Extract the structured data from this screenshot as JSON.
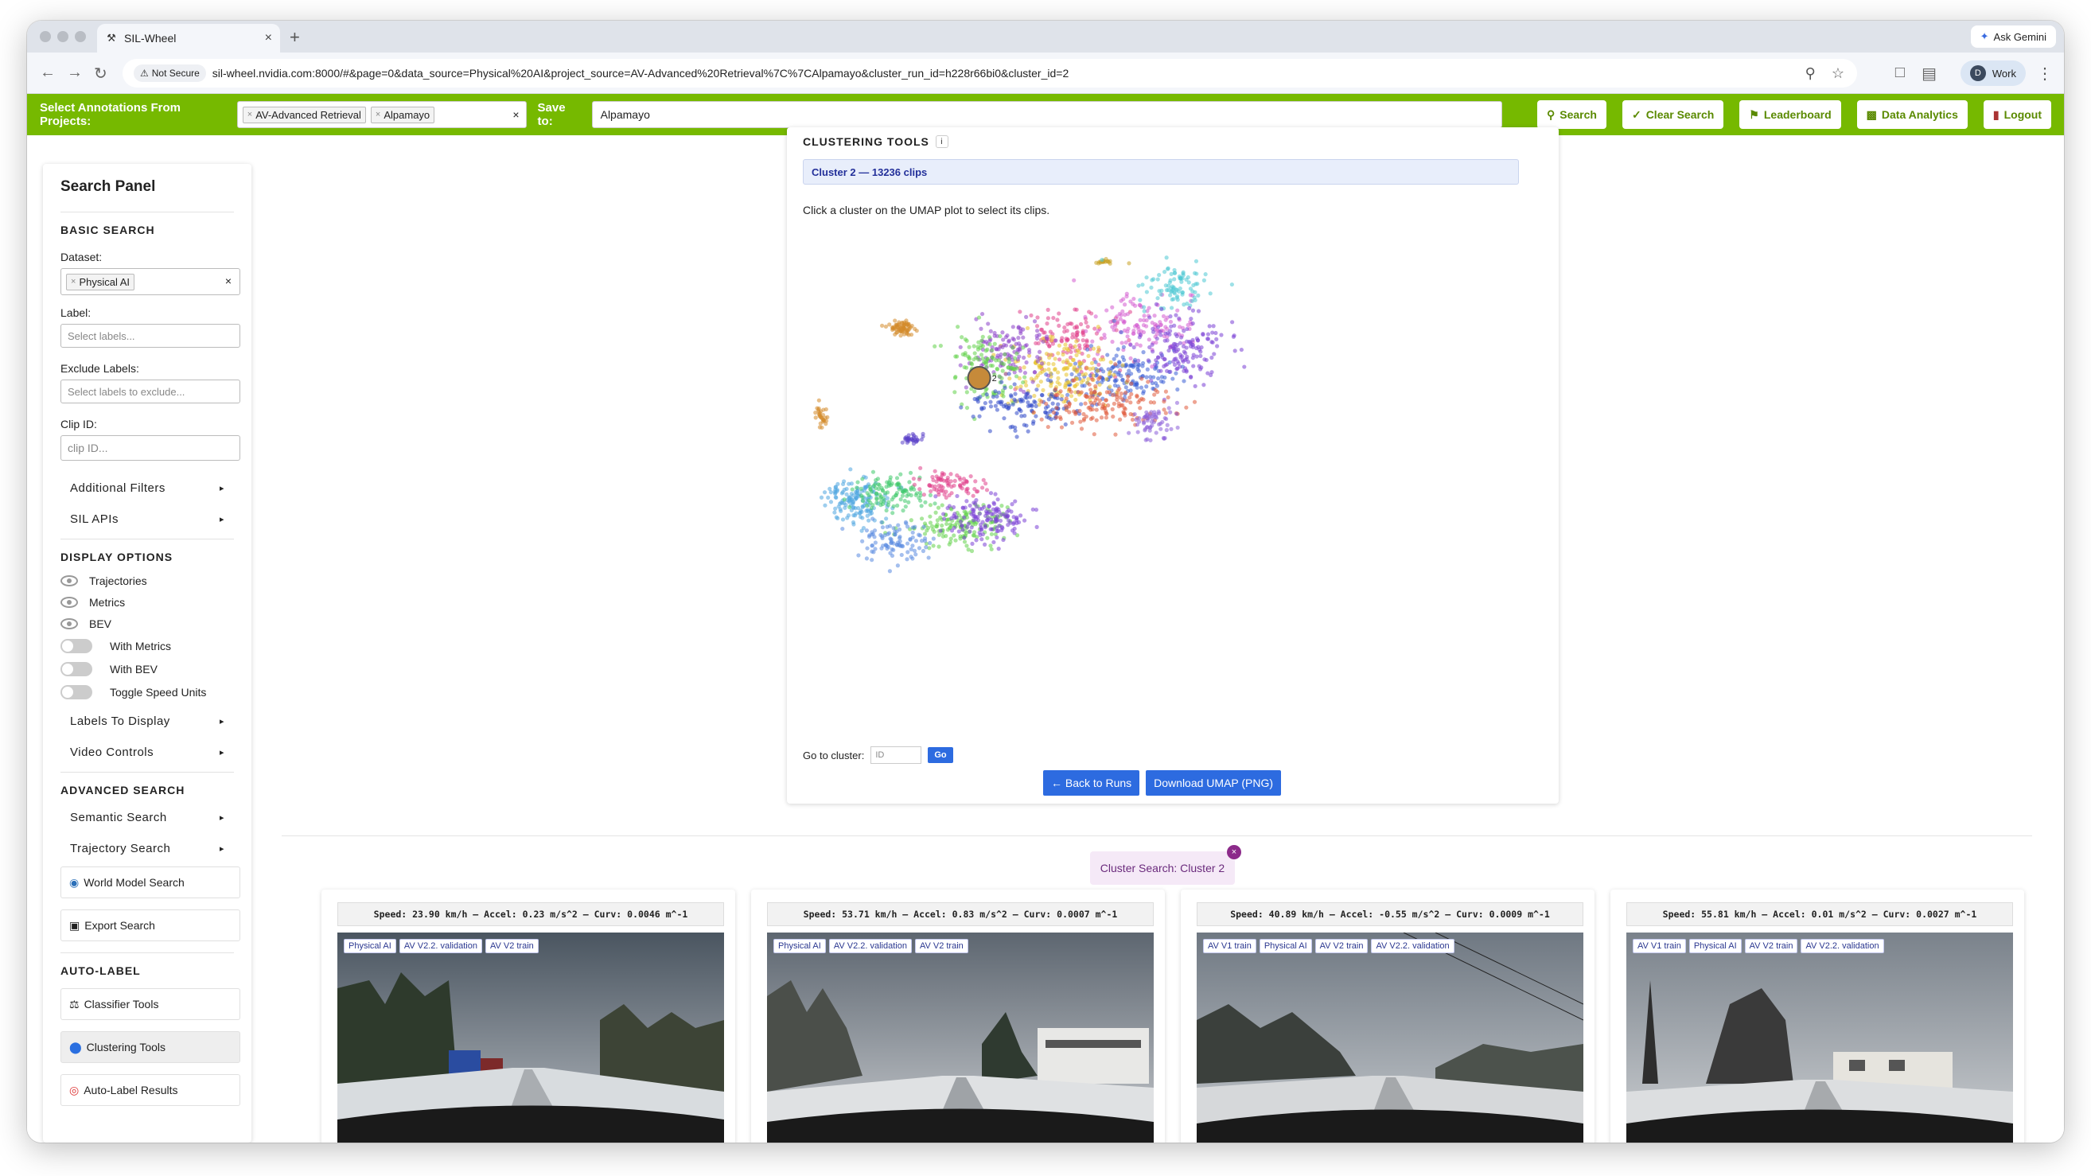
{
  "browser": {
    "tab_title": "SIL-Wheel",
    "new_tab": "+",
    "gemini_label": "Ask Gemini",
    "security_label": "Not Secure",
    "url": "sil-wheel.nvidia.com:8000/#&page=0&data_source=Physical%20AI&project_source=AV-Advanced%20Retrieval%7C%7CAlpamayo&cluster_run_id=h228r66bi0&cluster_id=2",
    "profile_initial": "D",
    "profile_label": "Work"
  },
  "appbar": {
    "select_label": "Select Annotations From Projects:",
    "projects": [
      "AV-Advanced Retrieval",
      "Alpamayo"
    ],
    "save_label": "Save to:",
    "save_value": "Alpamayo",
    "buttons": {
      "search": "Search",
      "clear": "Clear Search",
      "leaderboard": "Leaderboard",
      "analytics": "Data Analytics",
      "logout": "Logout"
    },
    "brand_color": "#76b900"
  },
  "sidebar": {
    "title": "Search Panel",
    "basic_search": "BASIC SEARCH",
    "dataset_label": "Dataset:",
    "dataset_value": "Physical AI",
    "label_label": "Label:",
    "label_placeholder": "Select labels...",
    "exclude_label": "Exclude Labels:",
    "exclude_placeholder": "Select labels to exclude...",
    "clip_label": "Clip ID:",
    "clip_placeholder": "clip ID...",
    "additional_filters": "Additional Filters",
    "sil_apis": "SIL APIs",
    "display_options": "DISPLAY OPTIONS",
    "opt_trajectories": "Trajectories",
    "opt_metrics": "Metrics",
    "opt_bev": "BEV",
    "with_metrics": "With Metrics",
    "with_bev": "With BEV",
    "speed_units": "Toggle Speed Units",
    "labels_to_display": "Labels To Display",
    "video_controls": "Video Controls",
    "advanced_search": "ADVANCED SEARCH",
    "semantic_search": "Semantic Search",
    "trajectory_search": "Trajectory Search",
    "world_model_search": "World Model Search",
    "export_search": "Export Search",
    "auto_label": "AUTO-LABEL",
    "classifier_tools": "Classifier Tools",
    "clustering_tools": "Clustering Tools",
    "auto_label_results": "Auto-Label Results"
  },
  "clustering": {
    "title": "CLUSTERING TOOLS",
    "badge": "i",
    "banner": "Cluster 2 — 13236 clips",
    "hint": "Click a cluster on the UMAP plot to select its clips.",
    "selected_label": "2",
    "goto_label": "Go to cluster:",
    "goto_placeholder": "ID",
    "goto_button": "Go",
    "back_button": "← Back to Runs",
    "download_button": "Download UMAP (PNG)"
  },
  "results": {
    "chip_label": "Cluster Search: Cluster 2",
    "chip_close": "×",
    "cards": [
      {
        "stats": "Speed: 23.90 km/h – Accel:  0.23 m/s^2 – Curv: 0.0046 m^-1",
        "tags": [
          "Physical AI",
          "AV V2.2. validation",
          "AV V2 train"
        ]
      },
      {
        "stats": "Speed: 53.71 km/h – Accel:  0.83 m/s^2 – Curv: 0.0007 m^-1",
        "tags": [
          "Physical AI",
          "AV V2.2. validation",
          "AV V2 train"
        ]
      },
      {
        "stats": "Speed: 40.89 km/h – Accel: -0.55 m/s^2 – Curv: 0.0009 m^-1",
        "tags": [
          "AV V1 train",
          "Physical AI",
          "AV V2 train",
          "AV V2.2. validation"
        ]
      },
      {
        "stats": "Speed: 55.81 km/h – Accel:  0.01 m/s^2 – Curv: 0.0027 m^-1",
        "tags": [
          "AV V1 train",
          "Physical AI",
          "AV V2 train",
          "AV V2.2. validation"
        ]
      }
    ]
  }
}
